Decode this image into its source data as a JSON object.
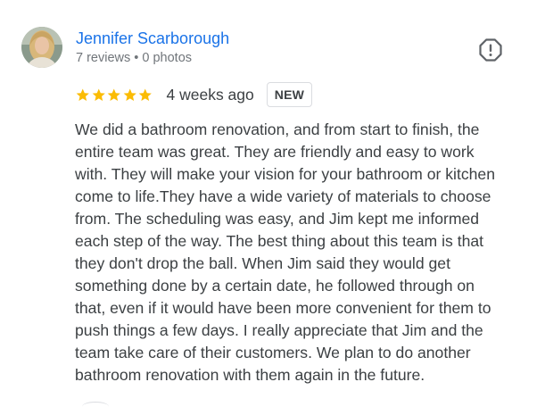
{
  "reviewer": {
    "name": "Jennifer Scarborough",
    "meta": "7 reviews • 0 photos",
    "avatar_icon": "user-photo"
  },
  "review": {
    "rating": 5,
    "rating_max": 5,
    "star_color": "#fbbc04",
    "time_ago": "4 weeks ago",
    "badge": "NEW",
    "text_lines": [
      "We did a bathroom renovation, and from start to finish, the",
      "entire team was great. They are friendly and easy to work",
      "with. They will make your vision for your bathroom or kitchen",
      "come to life.They have a wide variety of materials to choose",
      "from. The scheduling was easy, and Jim kept me informed",
      "each step of the way. The best thing about this team is that",
      "they don't drop the ball. When Jim said they would get",
      "something done by a certain date, he followed through on",
      "that, even if it would have been more convenient for them to",
      "push things a few days. I really appreciate that Jim and the",
      "team take care of their customers. We plan to do another",
      "bathroom renovation with them again in the future."
    ]
  },
  "actions": {
    "report_icon": "report-icon"
  },
  "colors": {
    "name_link": "#1a73e8",
    "secondary_text": "#70757a",
    "body_text": "#3c4043",
    "border": "#dadce0"
  }
}
